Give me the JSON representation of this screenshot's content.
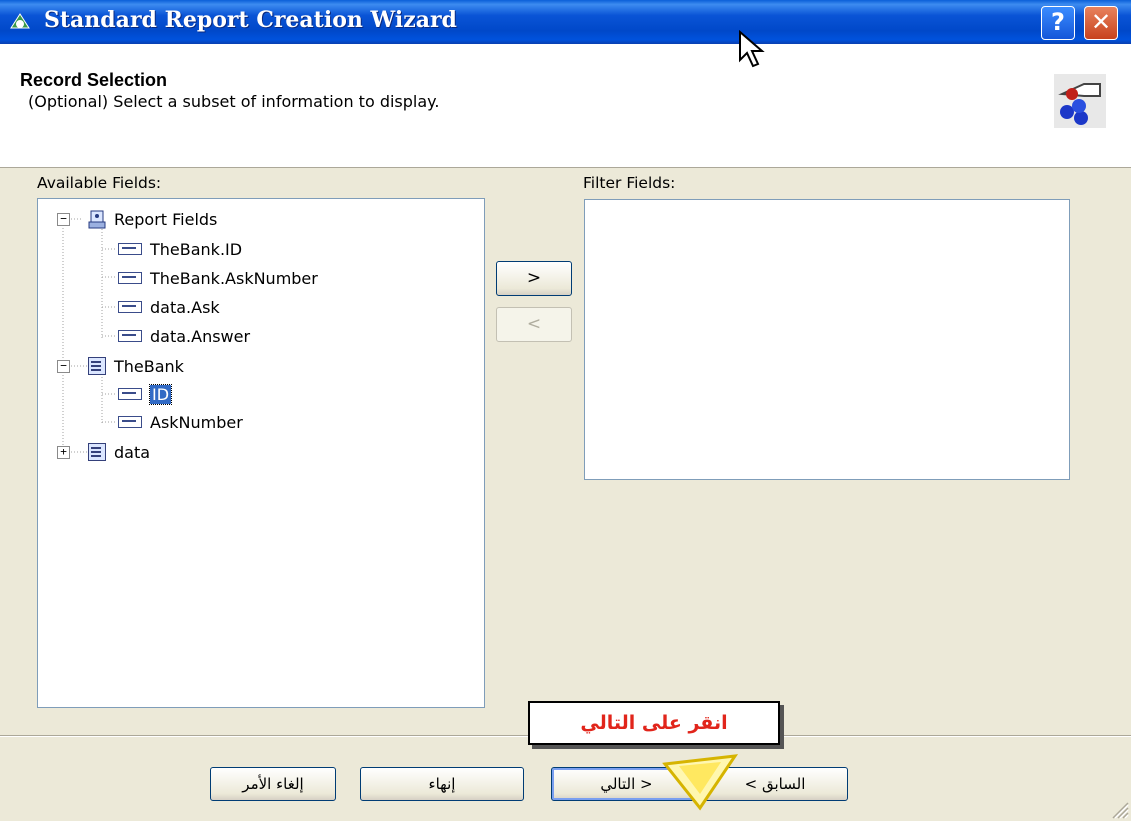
{
  "window": {
    "title": "Standard Report Creation Wizard",
    "help_label": "?",
    "close_label": "✕"
  },
  "header": {
    "title": "Record Selection",
    "subtitle": "(Optional)  Select a subset of information to display."
  },
  "available": {
    "label": "Available Fields:",
    "tree": [
      {
        "label": "Report Fields"
      },
      {
        "label": "TheBank.ID"
      },
      {
        "label": "TheBank.AskNumber"
      },
      {
        "label": "data.Ask"
      },
      {
        "label": "data.Answer"
      },
      {
        "label": "TheBank"
      },
      {
        "label": "ID"
      },
      {
        "label": "AskNumber"
      },
      {
        "label": "data"
      }
    ]
  },
  "filter": {
    "label": "Filter Fields:"
  },
  "move_buttons": {
    "add": ">",
    "remove": "<"
  },
  "callout": {
    "text": "انقر على التالي"
  },
  "buttons": {
    "back": "< السابق",
    "next": "التالي >",
    "finish": "إنهاء",
    "cancel": "إلغاء الأمر"
  },
  "icons": {
    "title": "wizard-icon",
    "header": "record-selection-icon"
  }
}
